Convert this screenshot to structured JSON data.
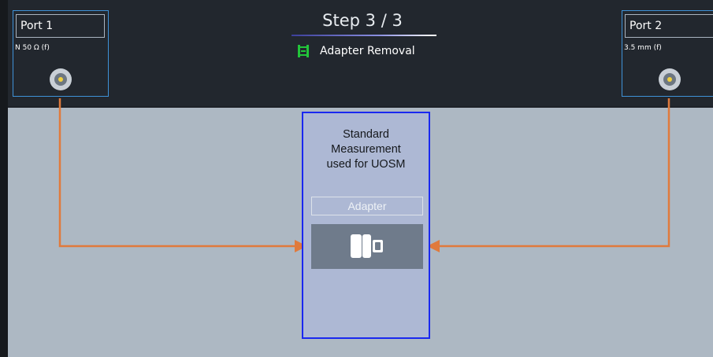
{
  "header": {
    "step": "Step 3 / 3",
    "step_name": "Adapter Removal"
  },
  "ports": [
    {
      "title": "Port 1",
      "connector": "N 50 Ω (f)"
    },
    {
      "title": "Port 2",
      "connector": "3.5 mm (f)"
    }
  ],
  "standard": {
    "label_line1": "Standard",
    "label_line2": "Measurement",
    "label_line3": "used for UOSM",
    "adapter_label": "Adapter"
  },
  "colors": {
    "cable": "#e07a3c",
    "selection": "#1a28f0",
    "port_border": "#3f92d8"
  }
}
